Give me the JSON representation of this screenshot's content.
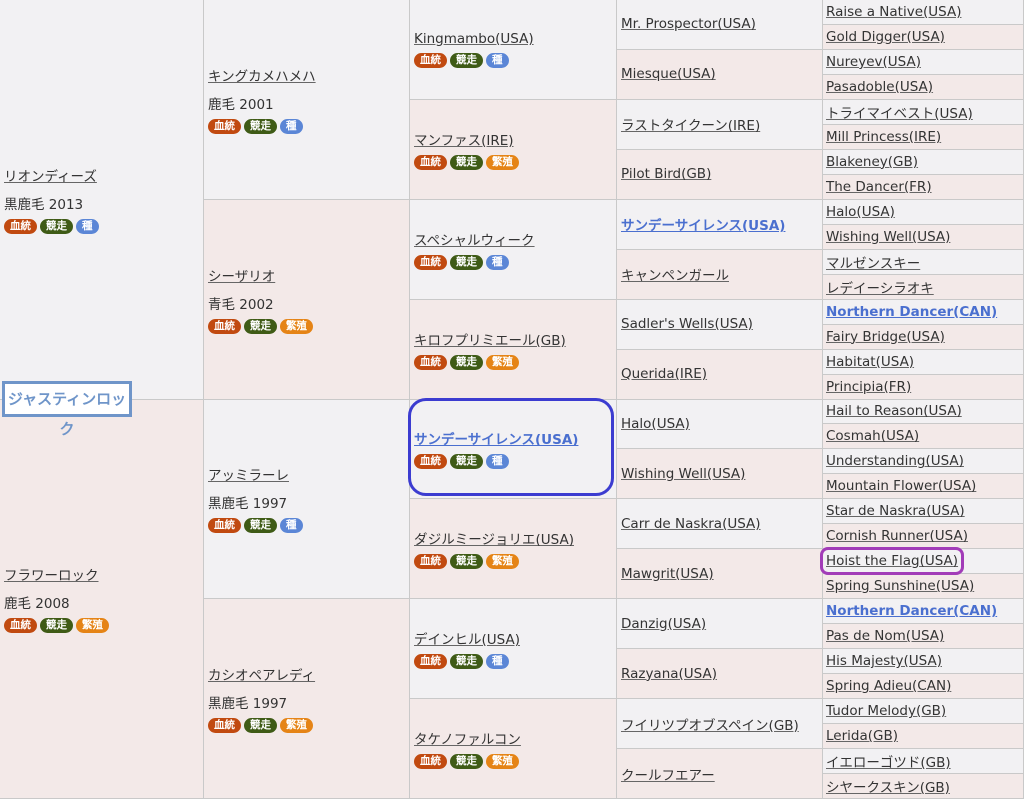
{
  "badges": {
    "blood": "血統",
    "race": "競走",
    "sire": "種",
    "broodmare": "繁殖"
  },
  "subject": "ジャスティンロック",
  "gen1": [
    {
      "name": "リオンディーズ",
      "sub": "黒鹿毛 2013",
      "badges": [
        "blood",
        "race",
        "sire"
      ]
    },
    {
      "name": "フラワーロック",
      "sub": "鹿毛 2008",
      "badges": [
        "blood",
        "race",
        "broodmare"
      ]
    }
  ],
  "gen2": [
    {
      "name": "キングカメハメハ",
      "sub": "鹿毛 2001",
      "badges": [
        "blood",
        "race",
        "sire"
      ]
    },
    {
      "name": "シーザリオ",
      "sub": "青毛 2002",
      "badges": [
        "blood",
        "race",
        "broodmare"
      ]
    },
    {
      "name": "アッミラーレ",
      "sub": "黒鹿毛 1997",
      "badges": [
        "blood",
        "race",
        "sire"
      ]
    },
    {
      "name": "カシオペアレディ",
      "sub": "黒鹿毛 1997",
      "badges": [
        "blood",
        "race",
        "broodmare"
      ]
    }
  ],
  "gen3": [
    {
      "name": "Kingmambo(USA)",
      "badges": [
        "blood",
        "race",
        "sire"
      ]
    },
    {
      "name": "マンファス(IRE)",
      "badges": [
        "blood",
        "race",
        "broodmare"
      ]
    },
    {
      "name": "スペシャルウィーク",
      "badges": [
        "blood",
        "race",
        "sire"
      ]
    },
    {
      "name": "キロフプリミエール(GB)",
      "badges": [
        "blood",
        "race",
        "broodmare"
      ]
    },
    {
      "name": "サンデーサイレンス(USA)",
      "bold": true,
      "badges": [
        "blood",
        "race",
        "sire"
      ]
    },
    {
      "name": "ダジルミージョリエ(USA)",
      "badges": [
        "blood",
        "race",
        "broodmare"
      ]
    },
    {
      "name": "デインヒル(USA)",
      "badges": [
        "blood",
        "race",
        "sire"
      ]
    },
    {
      "name": "タケノファルコン",
      "badges": [
        "blood",
        "race",
        "broodmare"
      ]
    }
  ],
  "gen4": [
    {
      "name": "Mr. Prospector(USA)"
    },
    {
      "name": "Miesque(USA)"
    },
    {
      "name": "ラストタイクーン(IRE)"
    },
    {
      "name": "Pilot Bird(GB)"
    },
    {
      "name": "サンデーサイレンス(USA)",
      "bold": true
    },
    {
      "name": "キャンペンガール"
    },
    {
      "name": "Sadler's Wells(USA)"
    },
    {
      "name": "Querida(IRE)"
    },
    {
      "name": "Halo(USA)"
    },
    {
      "name": "Wishing Well(USA)"
    },
    {
      "name": "Carr de Naskra(USA)"
    },
    {
      "name": "Mawgrit(USA)"
    },
    {
      "name": "Danzig(USA)"
    },
    {
      "name": "Razyana(USA)"
    },
    {
      "name": "フイリツプオブスペイン(GB)"
    },
    {
      "name": "クールフエアー"
    }
  ],
  "gen5": [
    {
      "name": "Raise a Native(USA)"
    },
    {
      "name": "Gold Digger(USA)"
    },
    {
      "name": "Nureyev(USA)"
    },
    {
      "name": "Pasadoble(USA)"
    },
    {
      "name": "トライマイベスト(USA)"
    },
    {
      "name": "Mill Princess(IRE)"
    },
    {
      "name": "Blakeney(GB)"
    },
    {
      "name": "The Dancer(FR)"
    },
    {
      "name": "Halo(USA)"
    },
    {
      "name": "Wishing Well(USA)"
    },
    {
      "name": "マルゼンスキー"
    },
    {
      "name": "レデイーシラオキ"
    },
    {
      "name": "Northern Dancer(CAN)",
      "bold": true
    },
    {
      "name": "Fairy Bridge(USA)"
    },
    {
      "name": "Habitat(USA)"
    },
    {
      "name": "Principia(FR)"
    },
    {
      "name": "Hail to Reason(USA)"
    },
    {
      "name": "Cosmah(USA)"
    },
    {
      "name": "Understanding(USA)"
    },
    {
      "name": "Mountain Flower(USA)"
    },
    {
      "name": "Star de Naskra(USA)"
    },
    {
      "name": "Cornish Runner(USA)"
    },
    {
      "name": "Hoist the Flag(USA)"
    },
    {
      "name": "Spring Sunshine(USA)"
    },
    {
      "name": "Northern Dancer(CAN)",
      "bold": true
    },
    {
      "name": "Pas de Nom(USA)"
    },
    {
      "name": "His Majesty(USA)"
    },
    {
      "name": "Spring Adieu(CAN)"
    },
    {
      "name": "Tudor Melody(GB)"
    },
    {
      "name": "Lerida(GB)"
    },
    {
      "name": "イエローゴツド(GB)"
    },
    {
      "name": "シヤークスキン(GB)"
    }
  ]
}
